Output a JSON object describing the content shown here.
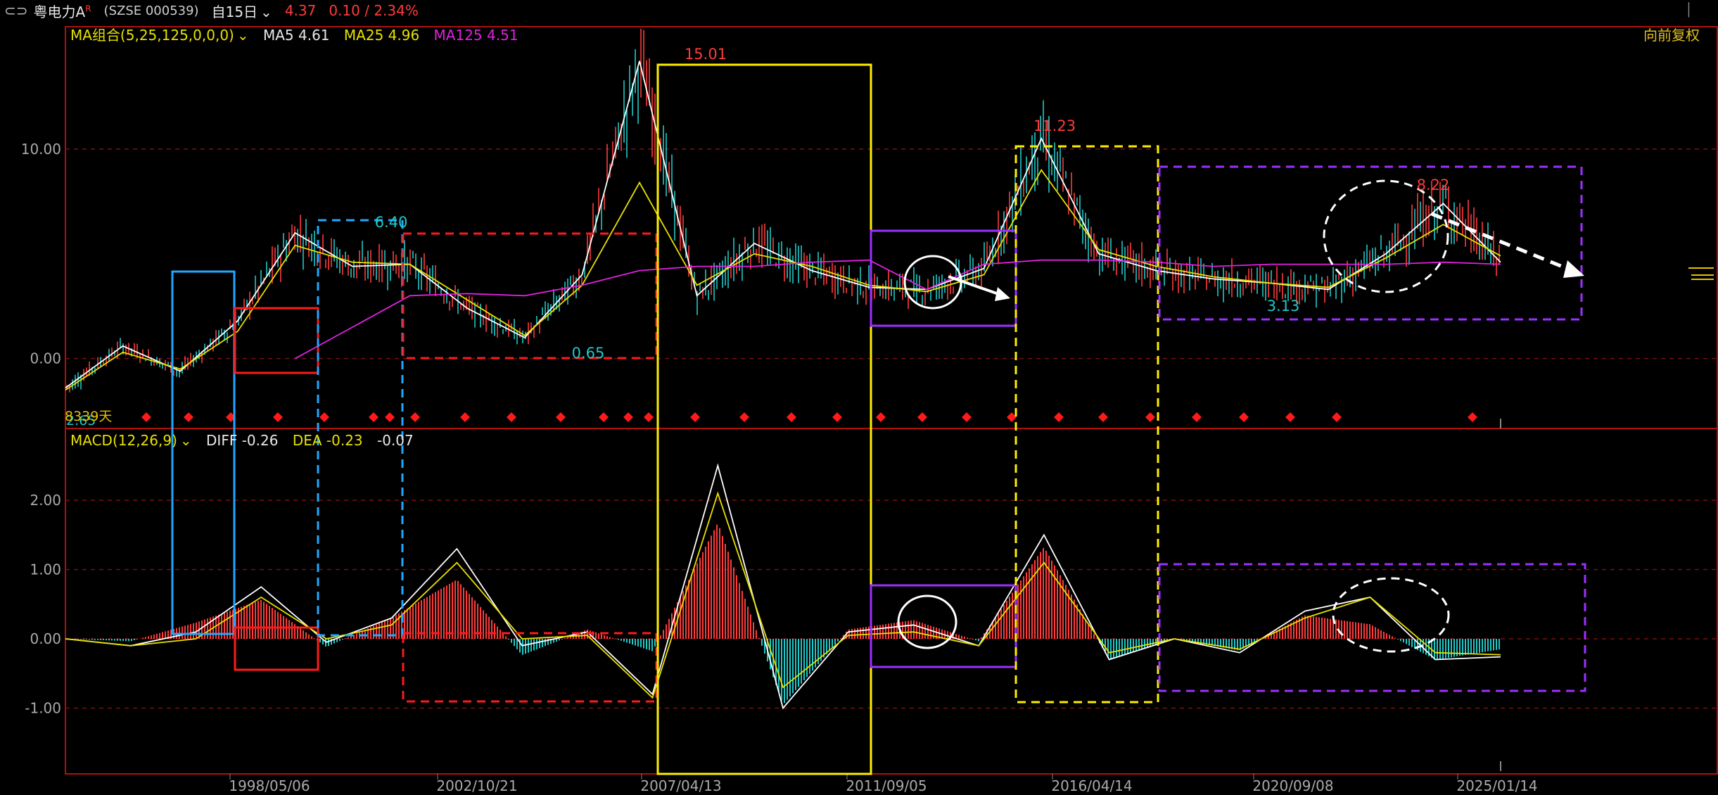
{
  "header": {
    "link_icon": "⊂⊃",
    "stock_name": "粤电力A",
    "superscript": "R",
    "exchange_code": "(SZSE 000539)",
    "period": "自15日",
    "price": "4.37",
    "change": "0.10 / 2.34%",
    "adjust_mode": "向前复权"
  },
  "ma_legend": {
    "label": "MA组合(5,25,125,0,0,0)",
    "ma5": "MA5 4.61",
    "ma25": "MA25 4.96",
    "ma125": "MA125 4.51",
    "colors": {
      "ma5": "#ffffff",
      "ma25": "#e8e000",
      "ma125": "#e020e0",
      "up": "#ff3b3b",
      "down": "#20c8c8"
    }
  },
  "macd_legend": {
    "label": "MACD(12,26,9)",
    "diff": "DIFF -0.26",
    "dea": "DEA -0.23",
    "macd": "-0.07"
  },
  "annotations": {
    "peak_1": "6.40",
    "peak_2": "15.01",
    "peak_3": "11.23",
    "peak_4": "8.22",
    "low_1": "0.65",
    "low_2": "3.13",
    "start_low": "2.65",
    "start_days": "8339天"
  },
  "chart_data": [
    {
      "type": "line",
      "title": "",
      "x": [
        "1998/05/06",
        "2002/10/21",
        "2007/04/13",
        "2011/09/05",
        "2016/04/14",
        "2020/09/08",
        "2025/01/14"
      ],
      "yticks": [
        "0.00",
        "10.00"
      ],
      "ylim": [
        -3.2,
        15.5
      ],
      "series": [
        {
          "name": "MA5",
          "values": [
            -1.4,
            0.6,
            -0.6,
            1.8,
            6.0,
            4.4,
            4.5,
            2.4,
            1.0,
            4.0,
            14.2,
            3.0,
            5.5,
            4.2,
            3.4,
            3.3,
            4.3,
            10.5,
            5.0,
            4.2,
            3.8,
            3.6,
            3.3,
            5.0,
            7.4,
            4.6
          ]
        },
        {
          "name": "MA25",
          "values": [
            -1.5,
            0.3,
            -0.5,
            1.3,
            5.4,
            4.6,
            4.5,
            2.8,
            1.1,
            3.5,
            8.4,
            3.5,
            5.0,
            4.4,
            3.5,
            3.2,
            4.0,
            9.0,
            5.2,
            4.4,
            3.9,
            3.6,
            3.4,
            4.8,
            6.4,
            4.9
          ]
        },
        {
          "name": "MA125",
          "values": [
            null,
            null,
            null,
            null,
            0.0,
            1.5,
            3.0,
            3.1,
            3.0,
            3.5,
            4.2,
            4.4,
            4.4,
            4.6,
            4.7,
            3.3,
            4.5,
            4.7,
            4.7,
            4.6,
            4.4,
            4.5,
            4.5,
            4.5,
            4.6,
            4.5
          ]
        }
      ],
      "annotated_values": {
        "highs": [
          6.4,
          15.01,
          11.23,
          8.22
        ],
        "lows": [
          0.65,
          3.13,
          2.65
        ]
      }
    },
    {
      "type": "line",
      "title": "",
      "yticks": [
        "2.00",
        "1.00",
        "0.00",
        "-1.00"
      ],
      "ylim": [
        -1.95,
        2.6
      ],
      "series": [
        {
          "name": "DIFF",
          "values": [
            0.0,
            -0.1,
            0.1,
            0.75,
            -0.05,
            0.3,
            1.3,
            -0.1,
            0.1,
            -0.8,
            2.5,
            -1.0,
            0.1,
            0.2,
            -0.1,
            1.5,
            -0.3,
            0.0,
            -0.2,
            0.4,
            0.6,
            -0.3,
            -0.26
          ]
        },
        {
          "name": "DEA",
          "values": [
            0.0,
            -0.1,
            0.0,
            0.6,
            0.0,
            0.2,
            1.1,
            0.0,
            0.05,
            -0.85,
            2.1,
            -0.7,
            0.05,
            0.1,
            -0.1,
            1.1,
            -0.2,
            0.0,
            -0.15,
            0.3,
            0.6,
            -0.2,
            -0.23
          ]
        }
      ]
    }
  ]
}
